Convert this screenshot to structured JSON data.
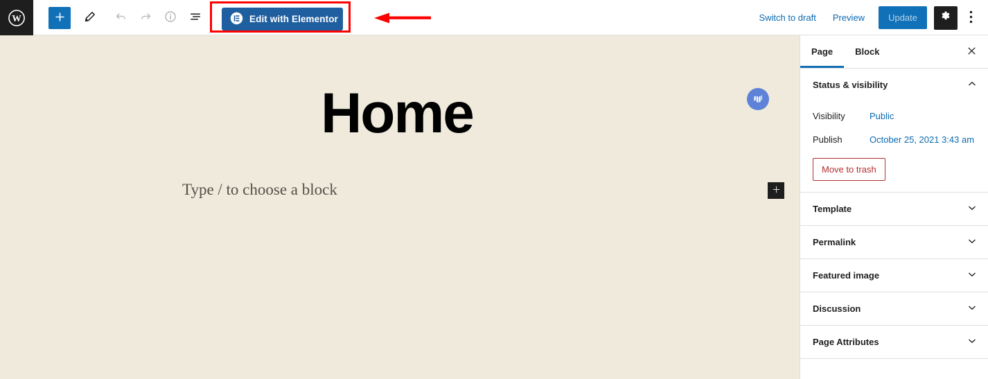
{
  "toolbar": {
    "wp_logo": "wordpress-logo",
    "inserter_label": "+",
    "icons": [
      {
        "name": "block-inserter-icon",
        "glyph": "+"
      },
      {
        "name": "tools-pencil-icon",
        "glyph": "pencil"
      },
      {
        "name": "undo-icon",
        "glyph": "undo"
      },
      {
        "name": "redo-icon",
        "glyph": "redo"
      },
      {
        "name": "details-info-icon",
        "glyph": "info"
      },
      {
        "name": "list-view-icon",
        "glyph": "list-view"
      }
    ],
    "elementor_button_label": "Edit with Elementor",
    "elementor_icon": "elementor-logo-icon",
    "switch_to_draft_label": "Switch to draft",
    "preview_label": "Preview",
    "update_label": "Update",
    "settings_icon": "gear-icon",
    "options_icon": "kebab-menu-icon",
    "highlight_color": "#fe0000",
    "elementor_button_color": "#1f5fa0",
    "update_button_color": "#1070b8"
  },
  "annotation": {
    "arrow_color": "#fe0000",
    "arrow_direction": "left"
  },
  "canvas": {
    "background_color": "#f0eadc",
    "post_title": "Home",
    "block_placeholder": "Type / to choose a block",
    "badge_icon": "monsterinsights-icon",
    "badge_color": "#5e82d8",
    "add_block_label": "+"
  },
  "sidebar": {
    "tabs": [
      {
        "label": "Page",
        "active": true
      },
      {
        "label": "Block",
        "active": false
      }
    ],
    "close_icon": "close-icon",
    "panels": [
      {
        "title": "Status & visibility",
        "expanded": true,
        "chevron": "chevron-up-icon",
        "rows": [
          {
            "label": "Visibility",
            "value": "Public"
          },
          {
            "label": "Publish",
            "value": "October 25, 2021 3:43 am"
          }
        ],
        "trash_label": "Move to trash"
      },
      {
        "title": "Template",
        "expanded": false,
        "chevron": "chevron-down-icon"
      },
      {
        "title": "Permalink",
        "expanded": false,
        "chevron": "chevron-down-icon"
      },
      {
        "title": "Featured image",
        "expanded": false,
        "chevron": "chevron-down-icon"
      },
      {
        "title": "Discussion",
        "expanded": false,
        "chevron": "chevron-down-icon"
      },
      {
        "title": "Page Attributes",
        "expanded": false,
        "chevron": "chevron-down-icon"
      }
    ],
    "accent_color": "#1070b8",
    "link_color": "#0b6ab0",
    "danger_color": "#b32d2e"
  }
}
